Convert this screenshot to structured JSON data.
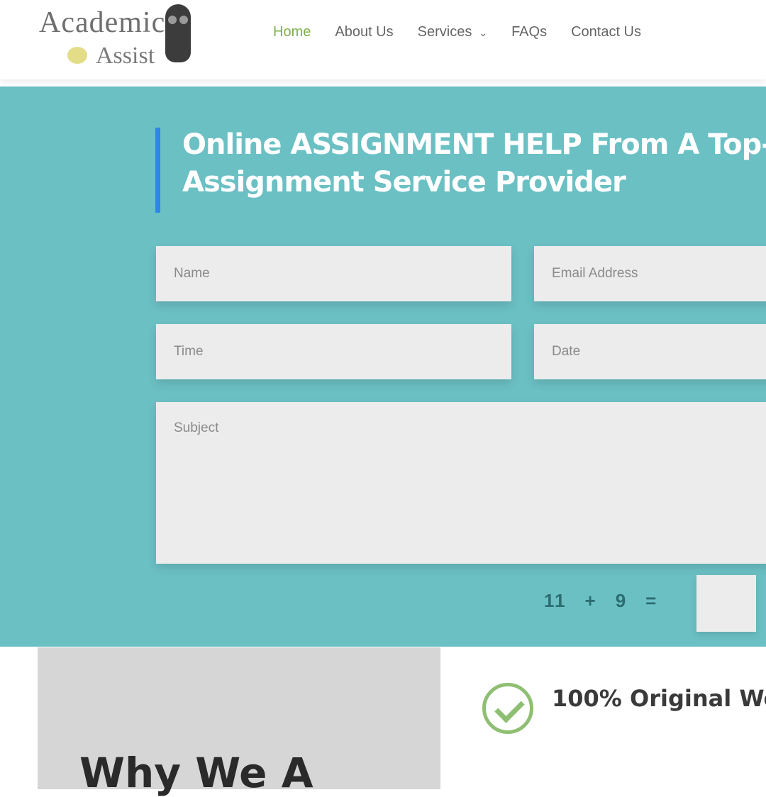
{
  "logo": {
    "line1": "Academic",
    "line2": "Assist"
  },
  "nav": {
    "items": [
      {
        "label": "Home",
        "active": true
      },
      {
        "label": "About Us"
      },
      {
        "label": "Services"
      },
      {
        "label": "FAQs"
      },
      {
        "label": "Contact Us"
      }
    ]
  },
  "hero": {
    "title": "Online ASSIGNMENT HELP From A Top-\nAssignment Service Provider"
  },
  "form": {
    "name_placeholder": "Name",
    "email_placeholder": "Email Address",
    "time_placeholder": "Time",
    "date_placeholder": "Date",
    "subject_placeholder": "Subject",
    "captcha": {
      "a": "11",
      "op": "+",
      "b": "9",
      "eq": "="
    }
  },
  "lower": {
    "gray_heading": "Why We A",
    "feature_title": "100% Original Wo"
  },
  "colors": {
    "hero_bg": "#6bc0c4",
    "accent_bar": "#2e86e8",
    "nav_active": "#7fb04a",
    "check": "#8fbf73"
  }
}
